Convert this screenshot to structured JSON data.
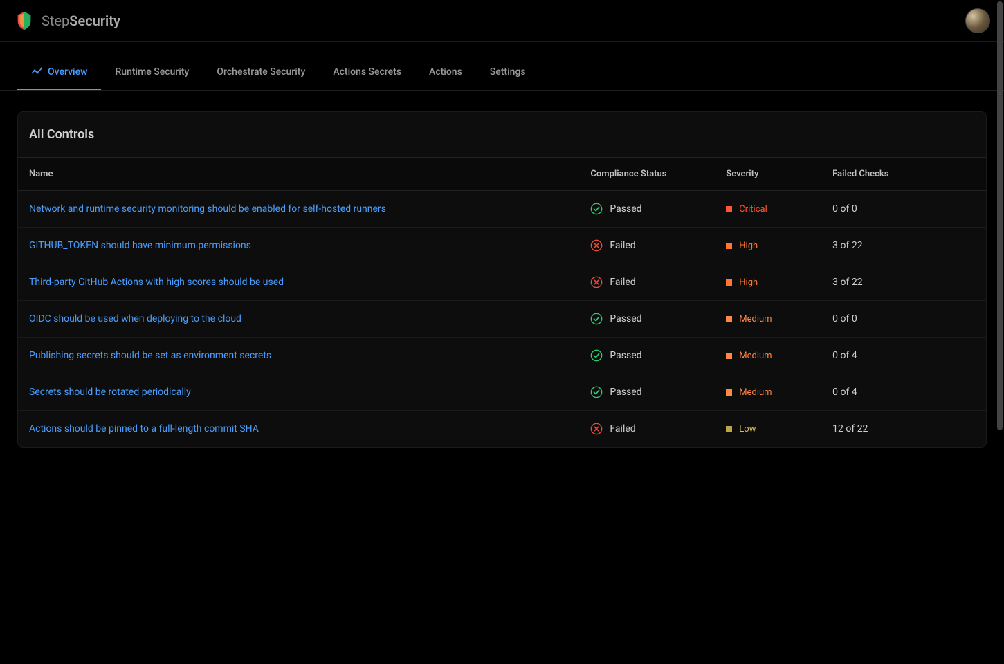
{
  "brand": {
    "name_light": "Step",
    "name_bold": "Security"
  },
  "tabs": [
    {
      "label": "Overview",
      "active": true
    },
    {
      "label": "Runtime Security",
      "active": false
    },
    {
      "label": "Orchestrate Security",
      "active": false
    },
    {
      "label": "Actions Secrets",
      "active": false
    },
    {
      "label": "Actions",
      "active": false
    },
    {
      "label": "Settings",
      "active": false
    }
  ],
  "panel": {
    "title": "All Controls",
    "columns": {
      "name": "Name",
      "status": "Compliance Status",
      "severity": "Severity",
      "failed": "Failed Checks"
    },
    "rows": [
      {
        "name": "Network and runtime security monitoring should be enabled for self-hosted runners",
        "status": "Passed",
        "severity": "Critical",
        "failed": "0 of 0"
      },
      {
        "name": "GITHUB_TOKEN should have minimum permissions",
        "status": "Failed",
        "severity": "High",
        "failed": "3 of 22"
      },
      {
        "name": "Third-party GitHub Actions with high scores should be used",
        "status": "Failed",
        "severity": "High",
        "failed": "3 of 22"
      },
      {
        "name": "OIDC should be used when deploying to the cloud",
        "status": "Passed",
        "severity": "Medium",
        "failed": "0 of 0"
      },
      {
        "name": "Publishing secrets should be set as environment secrets",
        "status": "Passed",
        "severity": "Medium",
        "failed": "0 of 4"
      },
      {
        "name": "Secrets should be rotated periodically",
        "status": "Passed",
        "severity": "Medium",
        "failed": "0 of 4"
      },
      {
        "name": "Actions should be pinned to a full-length commit SHA",
        "status": "Failed",
        "severity": "Low",
        "failed": "12 of 22"
      }
    ]
  }
}
